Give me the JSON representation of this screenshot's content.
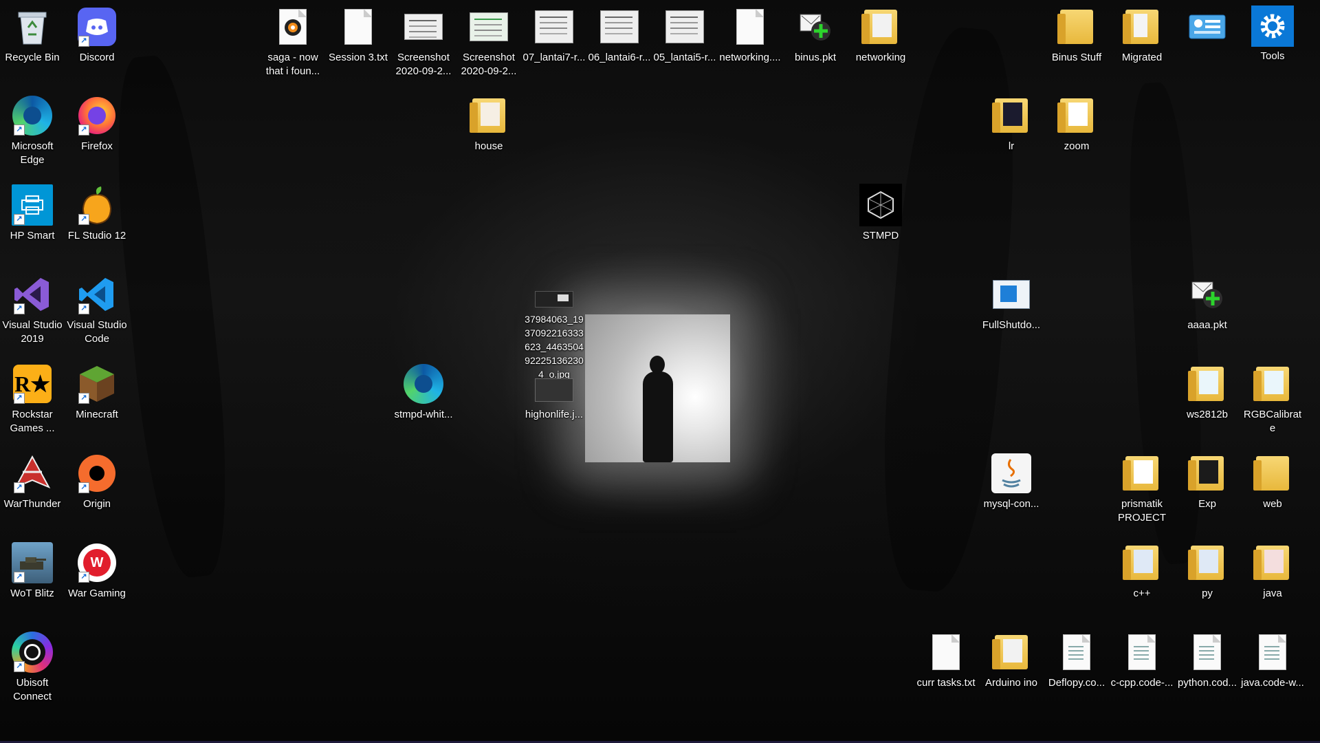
{
  "desktop": {
    "icons": [
      {
        "label": "Recycle Bin",
        "icon": "recycle-bin-icon"
      },
      {
        "label": "Discord",
        "icon": "discord-icon"
      },
      {
        "label": "saga - now that i foun...",
        "icon": "audio-file-icon"
      },
      {
        "label": "Session 3.txt",
        "icon": "text-file-icon"
      },
      {
        "label": "Screenshot 2020-09-2...",
        "icon": "image-thumbnail-icon"
      },
      {
        "label": "Screenshot 2020-09-2...",
        "icon": "image-thumbnail-icon"
      },
      {
        "label": "07_lantai7-r...",
        "icon": "floorplan-thumbnail-icon"
      },
      {
        "label": "06_lantai6-r...",
        "icon": "floorplan-thumbnail-icon"
      },
      {
        "label": "05_lantai5-r...",
        "icon": "floorplan-thumbnail-icon"
      },
      {
        "label": "networking....",
        "icon": "blank-file-icon"
      },
      {
        "label": "binus.pkt",
        "icon": "packet-tracer-icon"
      },
      {
        "label": "networking",
        "icon": "folder-icon"
      },
      {
        "label": "Binus Stuff",
        "icon": "folder-icon"
      },
      {
        "label": "Migrated",
        "icon": "folder-icon"
      },
      {
        "label": "",
        "icon": "control-panel-icon"
      },
      {
        "label": "Tools",
        "icon": "gear-icon"
      },
      {
        "label": "Microsoft Edge",
        "icon": "edge-icon"
      },
      {
        "label": "Firefox",
        "icon": "firefox-icon"
      },
      {
        "label": "house",
        "icon": "folder-icon"
      },
      {
        "label": "lr",
        "icon": "folder-icon"
      },
      {
        "label": "zoom",
        "icon": "folder-icon"
      },
      {
        "label": "HP Smart",
        "icon": "hp-smart-icon"
      },
      {
        "label": "FL Studio 12",
        "icon": "fl-studio-icon"
      },
      {
        "label": "STMPD",
        "icon": "stmpd-logo-icon"
      },
      {
        "label": "Visual Studio 2019",
        "icon": "visual-studio-icon"
      },
      {
        "label": "Visual Studio Code",
        "icon": "vscode-icon"
      },
      {
        "label": "37984063_1937092216333623_446350492225136230 4_o.jpg",
        "icon": "image-thumbnail-icon"
      },
      {
        "label": "FullShutdo...",
        "icon": "shutdown-shortcut-icon"
      },
      {
        "label": "aaaa.pkt",
        "icon": "packet-tracer-icon"
      },
      {
        "label": "Rockstar Games ...",
        "icon": "rockstar-icon"
      },
      {
        "label": "Minecraft",
        "icon": "minecraft-icon"
      },
      {
        "label": "stmpd-whit...",
        "icon": "edge-icon"
      },
      {
        "label": "highonlife.j...",
        "icon": "image-thumbnail-icon"
      },
      {
        "label": "ws2812b",
        "icon": "folder-icon"
      },
      {
        "label": "RGBCalibrate",
        "icon": "folder-icon"
      },
      {
        "label": "WarThunder",
        "icon": "warthunder-icon"
      },
      {
        "label": "Origin",
        "icon": "origin-icon"
      },
      {
        "label": "mysql-con...",
        "icon": "java-file-icon"
      },
      {
        "label": "prismatik PROJECT",
        "icon": "folder-icon"
      },
      {
        "label": "Exp",
        "icon": "folder-icon"
      },
      {
        "label": "web",
        "icon": "folder-icon"
      },
      {
        "label": "WoT Blitz",
        "icon": "wot-blitz-icon"
      },
      {
        "label": "War Gaming",
        "icon": "wargaming-icon"
      },
      {
        "label": "c++",
        "icon": "folder-icon"
      },
      {
        "label": "py",
        "icon": "folder-icon"
      },
      {
        "label": "java",
        "icon": "folder-icon"
      },
      {
        "label": "Ubisoft Connect",
        "icon": "ubisoft-icon"
      },
      {
        "label": "curr tasks.txt",
        "icon": "text-file-icon"
      },
      {
        "label": "Arduino ino",
        "icon": "folder-icon"
      },
      {
        "label": "Deflopy.co...",
        "icon": "code-workspace-file-icon"
      },
      {
        "label": "c-cpp.code-...",
        "icon": "code-workspace-file-icon"
      },
      {
        "label": "python.cod...",
        "icon": "code-workspace-file-icon"
      },
      {
        "label": "java.code-w...",
        "icon": "code-workspace-file-icon"
      }
    ]
  }
}
